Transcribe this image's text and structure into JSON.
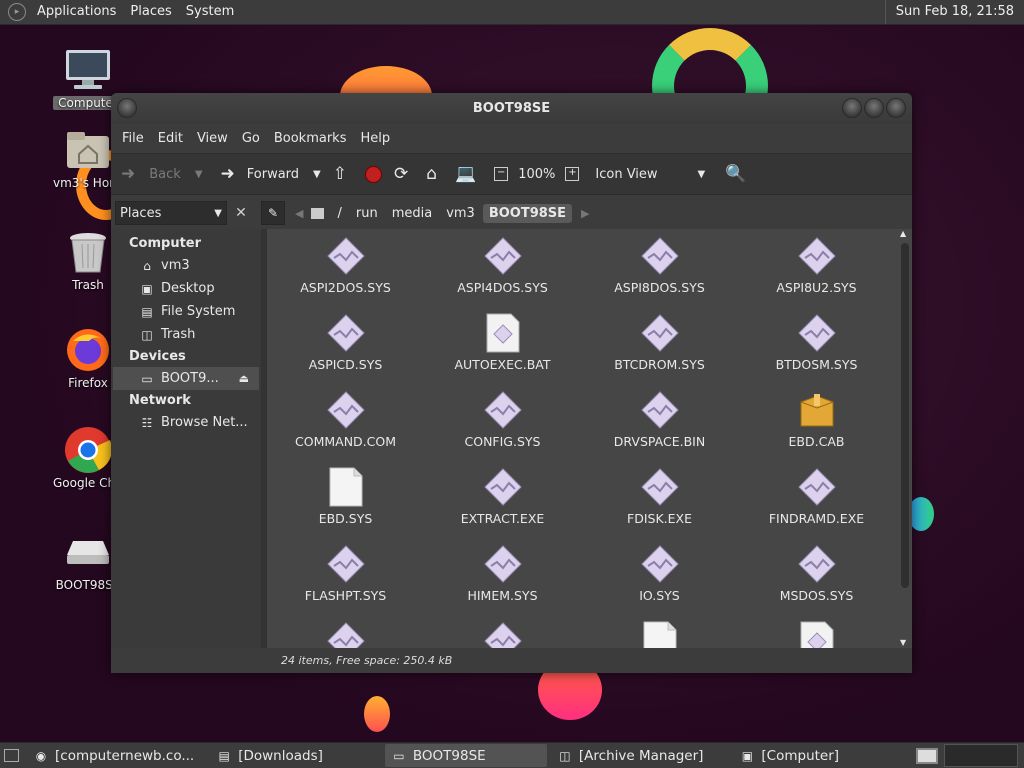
{
  "top_panel": {
    "menus": [
      "Applications",
      "Places",
      "System"
    ],
    "clock": "Sun Feb 18, 21:58"
  },
  "desktop_icons": [
    {
      "label": "Computer",
      "icon": "computer-icon"
    },
    {
      "label": "vm3's Home",
      "icon": "home-folder-icon"
    },
    {
      "label": "Trash",
      "icon": "trash-icon"
    },
    {
      "label": "Firefox",
      "icon": "firefox-icon"
    },
    {
      "label": "Google Chrome",
      "icon": "chrome-icon"
    },
    {
      "label": "BOOT98SE",
      "icon": "drive-icon"
    }
  ],
  "window": {
    "title": "BOOT98SE",
    "menu": [
      "File",
      "Edit",
      "View",
      "Go",
      "Bookmarks",
      "Help"
    ],
    "toolbar": {
      "back": "Back",
      "forward": "Forward",
      "zoom": "100%",
      "view_mode": "Icon View"
    },
    "places_select": "Places",
    "breadcrumbs": [
      "/",
      "run",
      "media",
      "vm3",
      "BOOT98SE"
    ],
    "sidebar": {
      "computer_header": "Computer",
      "computer_items": [
        {
          "label": "vm3",
          "icon": "home-icon"
        },
        {
          "label": "Desktop",
          "icon": "desktop-icon"
        },
        {
          "label": "File System",
          "icon": "drive-icon"
        },
        {
          "label": "Trash",
          "icon": "trash-icon"
        }
      ],
      "devices_header": "Devices",
      "devices_items": [
        {
          "label": "BOOT9...",
          "icon": "drive-icon"
        }
      ],
      "network_header": "Network",
      "network_items": [
        {
          "label": "Browse Net...",
          "icon": "network-icon"
        }
      ]
    },
    "files": [
      {
        "name": "ASPI2DOS.SYS",
        "type": "sys"
      },
      {
        "name": "ASPI4DOS.SYS",
        "type": "sys"
      },
      {
        "name": "ASPI8DOS.SYS",
        "type": "sys"
      },
      {
        "name": "ASPI8U2.SYS",
        "type": "sys"
      },
      {
        "name": "ASPICD.SYS",
        "type": "sys"
      },
      {
        "name": "AUTOEXEC.BAT",
        "type": "script"
      },
      {
        "name": "BTCDROM.SYS",
        "type": "sys"
      },
      {
        "name": "BTDOSM.SYS",
        "type": "sys"
      },
      {
        "name": "COMMAND.COM",
        "type": "sys"
      },
      {
        "name": "CONFIG.SYS",
        "type": "sys"
      },
      {
        "name": "DRVSPACE.BIN",
        "type": "sys"
      },
      {
        "name": "EBD.CAB",
        "type": "archive"
      },
      {
        "name": "EBD.SYS",
        "type": "blank"
      },
      {
        "name": "EXTRACT.EXE",
        "type": "sys"
      },
      {
        "name": "FDISK.EXE",
        "type": "sys"
      },
      {
        "name": "FINDRAMD.EXE",
        "type": "sys"
      },
      {
        "name": "FLASHPT.SYS",
        "type": "sys"
      },
      {
        "name": "HIMEM.SYS",
        "type": "sys"
      },
      {
        "name": "IO.SYS",
        "type": "sys"
      },
      {
        "name": "MSDOS.SYS",
        "type": "sys"
      },
      {
        "name": "",
        "type": "sys"
      },
      {
        "name": "",
        "type": "sys"
      },
      {
        "name": "",
        "type": "blank"
      },
      {
        "name": "",
        "type": "script"
      }
    ],
    "status": "24 items, Free space: 250.4 kB"
  },
  "taskbar": {
    "tasks": [
      {
        "label": "[computernewb.co...",
        "icon": "chrome-icon",
        "active": false
      },
      {
        "label": "[Downloads]",
        "icon": "folder-icon",
        "active": false
      },
      {
        "label": "BOOT98SE",
        "icon": "drive-icon",
        "active": true
      },
      {
        "label": "[Archive Manager]",
        "icon": "archive-icon",
        "active": false
      },
      {
        "label": "[Computer]",
        "icon": "computer-icon",
        "active": false
      }
    ]
  }
}
